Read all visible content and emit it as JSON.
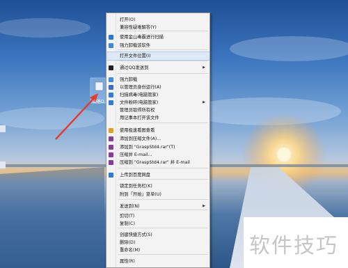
{
  "desktop": {
    "icon_label": "山爸D...",
    "colors": {
      "arrow": "#e53a2e",
      "sun": "#fff3c4"
    }
  },
  "menu": {
    "items": [
      {
        "label": "打开(O)",
        "icon": null
      },
      {
        "label": "兼容性疑难解答(Y)",
        "icon": null
      },
      {
        "label": "使用金山毒霸进行扫描",
        "icon": "jinshan-shield-icon",
        "color": "#2a78d8"
      },
      {
        "label": "强力卸载该软件",
        "icon": "uninstall-icon",
        "color": "#3a88e0"
      },
      {
        "label": "打开文件位置(I)",
        "icon": null
      },
      {
        "label": "通过QQ发送到",
        "icon": "qq-penguin-icon",
        "color": "#222222",
        "submenu": true
      },
      {
        "label": "强力卸载",
        "icon": "uninstall-icon",
        "color": "#3c8de0"
      },
      {
        "label": "以管理员身份运行(A)",
        "icon": "uac-shield-icon",
        "color": "#3a6fc8"
      },
      {
        "label": "扫描病毒(电脑管家)",
        "icon": "pc-manager-icon",
        "color": "#2d7de0"
      },
      {
        "label": "文件粉碎(电脑管家)",
        "icon": "pc-manager-icon",
        "color": "#2d7de0",
        "submenu": true
      },
      {
        "label": "管理员取得所有权",
        "icon": null
      },
      {
        "label": "用记事本打开该文件",
        "icon": null
      },
      {
        "label": "使用极速看图查看",
        "icon": "image-viewer-icon",
        "color": "#e0a020"
      },
      {
        "label": "添加到压缩文件(A)...",
        "icon": "winrar-icon",
        "color": "#8a3a9a"
      },
      {
        "label": "添加到 \"GraspStd4.rar\"(T)",
        "icon": "winrar-icon",
        "color": "#8a3a9a"
      },
      {
        "label": "压缩并 E-mail...",
        "icon": "winrar-icon",
        "color": "#8a3a9a"
      },
      {
        "label": "压缩到 \"GraspStd4.rar\" 并 E-mail",
        "icon": "winrar-icon",
        "color": "#8a3a9a"
      },
      {
        "label": "上传到百度网盘",
        "icon": "baidu-cloud-icon",
        "color": "#2f7ad8"
      },
      {
        "label": "锁定到任务栏(K)",
        "icon": null
      },
      {
        "label": "附到「开始」菜单(U)",
        "icon": null
      },
      {
        "label": "发送到(N)",
        "icon": null,
        "submenu": true
      },
      {
        "label": "剪切(T)",
        "icon": null
      },
      {
        "label": "复制(C)",
        "icon": null
      },
      {
        "label": "创建快捷方式(S)",
        "icon": null
      },
      {
        "label": "删除(D)",
        "icon": null
      },
      {
        "label": "重命名(M)",
        "icon": null
      },
      {
        "label": "属性(R)",
        "icon": null
      }
    ],
    "highlighted": 4
  },
  "watermark": {
    "text": "软件技巧"
  }
}
